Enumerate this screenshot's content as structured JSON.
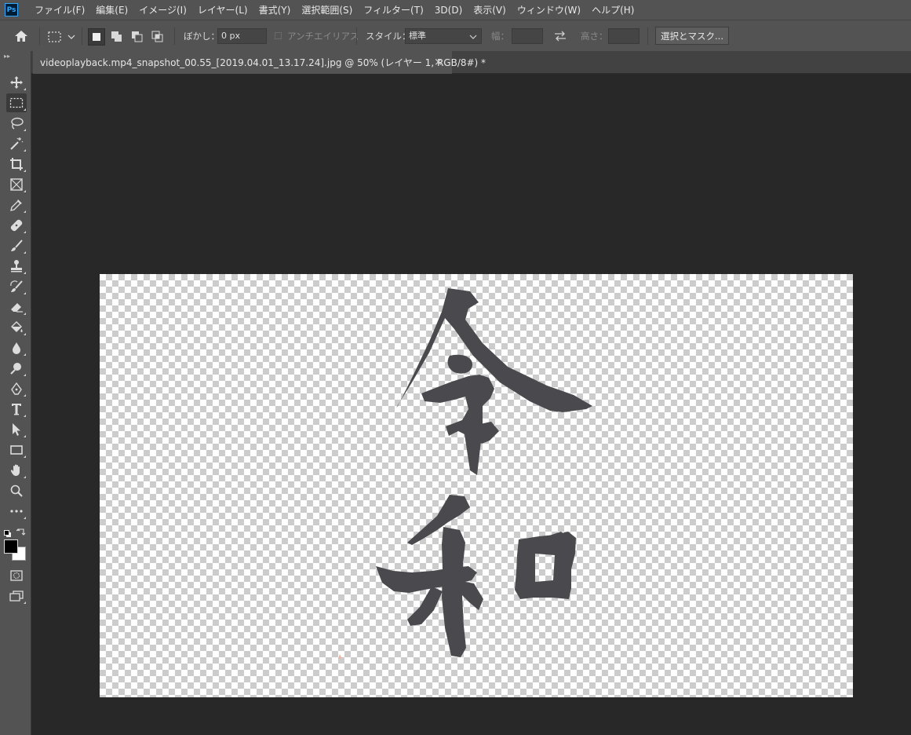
{
  "app": {
    "logo": "Ps"
  },
  "menu": [
    "ファイル(F)",
    "編集(E)",
    "イメージ(I)",
    "レイヤー(L)",
    "書式(Y)",
    "選択範囲(S)",
    "フィルター(T)",
    "3D(D)",
    "表示(V)",
    "ウィンドウ(W)",
    "ヘルプ(H)"
  ],
  "options": {
    "feather_label": "ぼかし：",
    "feather_value": "0 px",
    "antialias_label": "アンチエイリアス",
    "style_label": "スタイル：",
    "style_value": "標準",
    "width_label": "幅：",
    "width_value": "",
    "height_label": "高さ：",
    "height_value": "",
    "select_mask_button": "選択とマスク..."
  },
  "document": {
    "tab_title": "videoplayback.mp4_snapshot_00.55_[2019.04.01_13.17.24].jpg @ 50% (レイヤー 1, RGB/8#) *",
    "close_symbol": "×",
    "canvas_artwork": "令和"
  },
  "tools": [
    "move-tool",
    "rect-marquee-tool",
    "lasso-tool",
    "magic-wand-tool",
    "crop-tool",
    "frame-tool",
    "eyedropper-tool",
    "healing-brush-tool",
    "brush-tool",
    "clone-stamp-tool",
    "history-brush-tool",
    "eraser-tool",
    "paint-bucket-tool",
    "blur-tool",
    "dodge-tool",
    "pen-tool",
    "type-tool",
    "path-selection-tool",
    "rectangle-tool",
    "hand-tool",
    "zoom-tool",
    "more-tools",
    "quick-mask",
    "screen-mode"
  ],
  "colors": {
    "foreground": "#000000",
    "background": "#ffffff",
    "ink": "#4a4a4e",
    "accent": "#31a8ff"
  }
}
